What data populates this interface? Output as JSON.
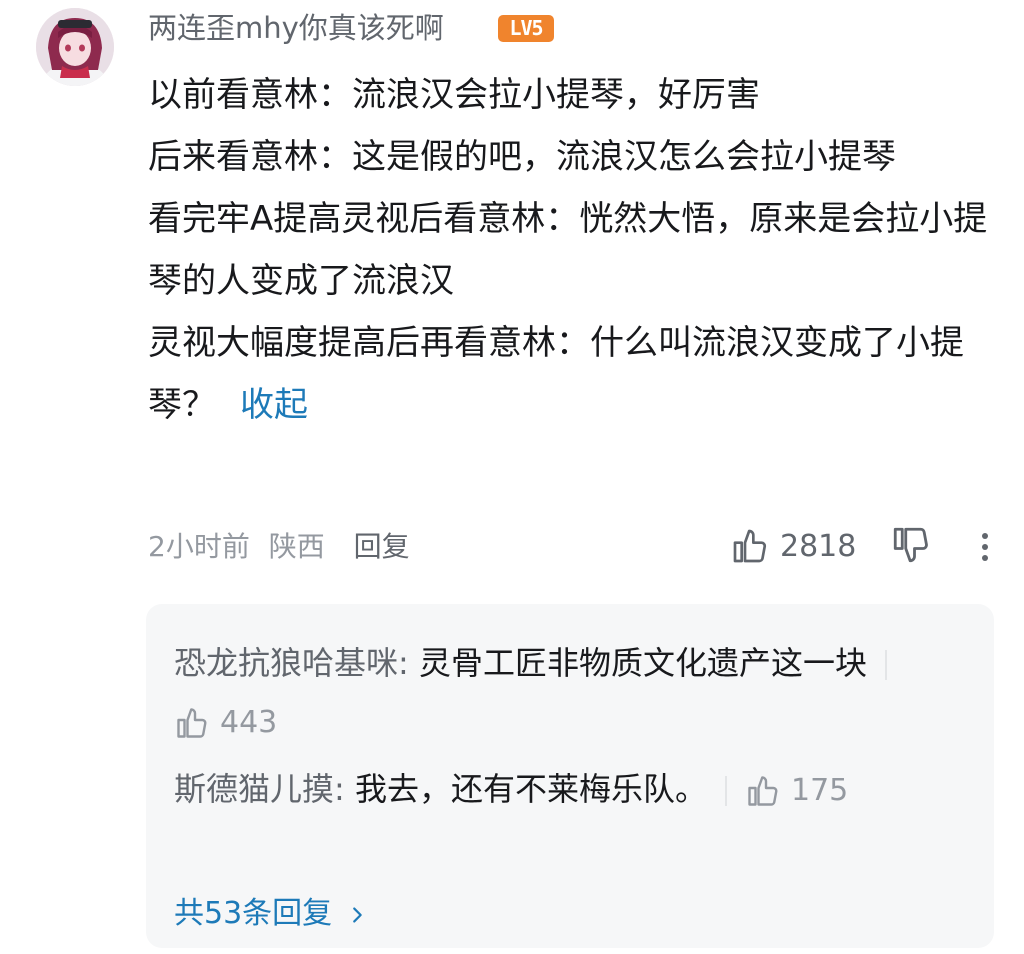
{
  "comment": {
    "username": "两连歪mhy你真该死啊",
    "level_badge": "LV5",
    "lines": [
      "以前看意林：流浪汉会拉小提琴，好厉害",
      "后来看意林：这是假的吧，流浪汉怎么会拉小提琴",
      "看完牢A提高灵视后看意林：恍然大悟，原来是会拉小提琴的人变成了流浪汉",
      "灵视大幅度提高后再看意林：什么叫流浪汉变成了小提琴？"
    ],
    "collapse_label": "收起",
    "time": "2小时前",
    "location": "陕西",
    "reply_label": "回复",
    "like_count": "2818"
  },
  "replies": [
    {
      "name": "恐龙抗狼哈基咪:",
      "text": " 灵骨工匠非物质文化遗产这一块",
      "likes": "443"
    },
    {
      "name": "斯德猫儿摸:",
      "text": " 我去，还有不莱梅乐队。",
      "likes": "175"
    }
  ],
  "total_replies_label": "共53条回复",
  "colors": {
    "link": "#1d7ab8",
    "level_badge": "#f0842d",
    "reply_box": "#f6f7f8"
  }
}
